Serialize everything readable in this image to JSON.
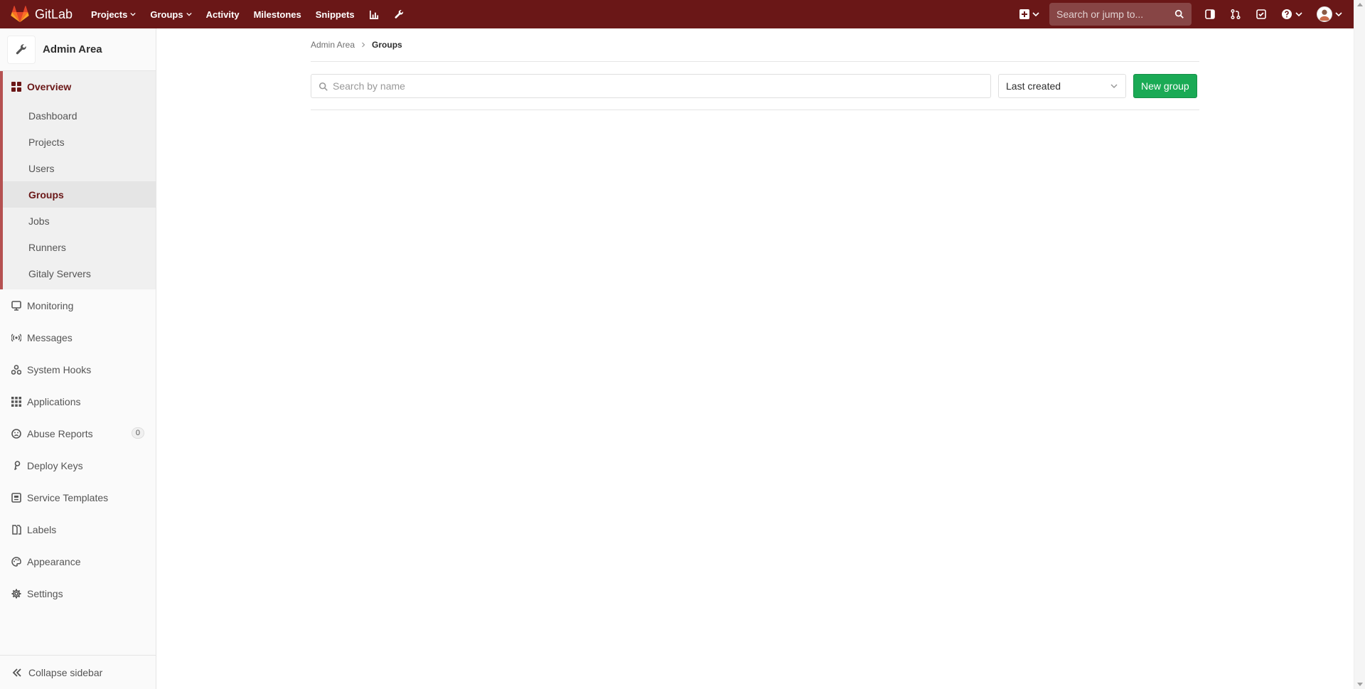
{
  "navbar": {
    "brand": "GitLab",
    "links": [
      {
        "label": "Projects",
        "has_caret": true
      },
      {
        "label": "Groups",
        "has_caret": true
      },
      {
        "label": "Activity",
        "has_caret": false
      },
      {
        "label": "Milestones",
        "has_caret": false
      },
      {
        "label": "Snippets",
        "has_caret": false
      }
    ],
    "extra_icons": [
      "chart-icon",
      "wrench-icon"
    ],
    "search_placeholder": "Search or jump to...",
    "right_icons": [
      "sidebar-toggle-icon",
      "merge-request-icon",
      "todo-check-icon",
      "help-icon"
    ]
  },
  "sidebar": {
    "context_title": "Admin Area",
    "section_title": "Overview",
    "sub_items": [
      {
        "label": "Dashboard",
        "active": false
      },
      {
        "label": "Projects",
        "active": false
      },
      {
        "label": "Users",
        "active": false
      },
      {
        "label": "Groups",
        "active": true
      },
      {
        "label": "Jobs",
        "active": false
      },
      {
        "label": "Runners",
        "active": false
      },
      {
        "label": "Gitaly Servers",
        "active": false
      }
    ],
    "items": [
      {
        "label": "Monitoring",
        "icon": "monitor-icon"
      },
      {
        "label": "Messages",
        "icon": "broadcast-icon"
      },
      {
        "label": "System Hooks",
        "icon": "hook-icon"
      },
      {
        "label": "Applications",
        "icon": "applications-icon"
      },
      {
        "label": "Abuse Reports",
        "icon": "abuse-icon",
        "badge": "0"
      },
      {
        "label": "Deploy Keys",
        "icon": "key-icon"
      },
      {
        "label": "Service Templates",
        "icon": "template-icon"
      },
      {
        "label": "Labels",
        "icon": "labels-icon"
      },
      {
        "label": "Appearance",
        "icon": "palette-icon"
      },
      {
        "label": "Settings",
        "icon": "settings-icon"
      }
    ],
    "collapse_label": "Collapse sidebar"
  },
  "main": {
    "breadcrumb": [
      "Admin Area",
      "Groups"
    ],
    "search_placeholder": "Search by name",
    "sort_value": "Last created",
    "new_group_label": "New group"
  },
  "colors": {
    "navbar": "#6a1717",
    "accent": "#6a1717",
    "sidebar_border": "#b55151",
    "new_button": "#1aaa55"
  }
}
